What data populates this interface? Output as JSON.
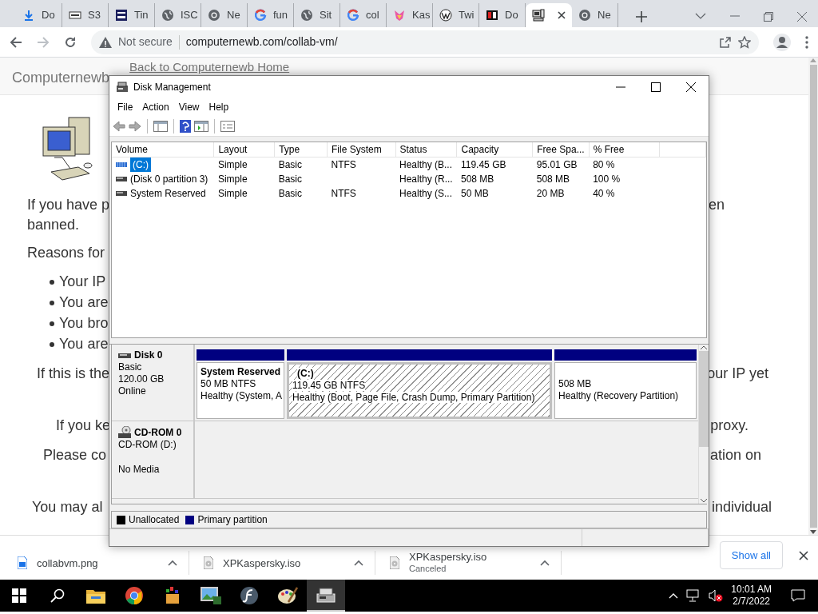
{
  "browser": {
    "tabs": [
      {
        "label": "Do",
        "kind": "download",
        "selected": false
      },
      {
        "label": "S3",
        "kind": "oem",
        "selected": false
      },
      {
        "label": "Tin",
        "kind": "tinyurl",
        "selected": false
      },
      {
        "label": "ISC",
        "kind": "globe",
        "selected": false
      },
      {
        "label": "Ne",
        "kind": "chrome",
        "selected": false
      },
      {
        "label": "fun",
        "kind": "google",
        "selected": false
      },
      {
        "label": "Sit",
        "kind": "globe",
        "selected": false
      },
      {
        "label": "col",
        "kind": "google",
        "selected": false
      },
      {
        "label": "Kas",
        "kind": "fox",
        "selected": false
      },
      {
        "label": "Twi",
        "kind": "wiki",
        "selected": false
      },
      {
        "label": "Do",
        "kind": "nch",
        "selected": false
      },
      {
        "kind": "computer",
        "selected": true
      },
      {
        "label": "Ne",
        "kind": "chrome",
        "selected": false
      }
    ],
    "security": "Not secure",
    "url": "computernewb.com/collab-vm/"
  },
  "website": {
    "brand": "Computernewb",
    "nav_link": "Back to Computernewb Home",
    "lines": [
      {
        "kind": "paragraph",
        "left": "If you have p",
        "right": "en"
      },
      {
        "kind": "paragraph",
        "left": "banned."
      },
      {
        "kind": "paragraph",
        "left": "Reasons for"
      },
      {
        "kind": "bullet",
        "left": "Your IP"
      },
      {
        "kind": "bullet",
        "left": "You are"
      },
      {
        "kind": "bullet",
        "left": "You bro"
      },
      {
        "kind": "bullet",
        "left": "You are"
      },
      {
        "kind": "paragraph",
        "left": "If this is the",
        "right": "our IP yet"
      },
      {
        "kind": "paragraph",
        "left": "If you ke",
        "right": "proxy."
      },
      {
        "kind": "paragraph",
        "left": "Please co",
        "right": "ation on"
      },
      {
        "kind": "paragraph",
        "left": "You may al",
        "right": "individual"
      }
    ]
  },
  "disk_management": {
    "title": "Disk Management",
    "menu": [
      "File",
      "Action",
      "View",
      "Help"
    ],
    "columns": [
      "Volume",
      "Layout",
      "Type",
      "File System",
      "Status",
      "Capacity",
      "Free Spa...",
      "% Free"
    ],
    "volumes": [
      {
        "cells": [
          "(C:)",
          "Simple",
          "Basic",
          "NTFS",
          "Healthy (B...",
          "119.45 GB",
          "95.01 GB",
          "80 %"
        ],
        "selected": true
      },
      {
        "cells": [
          "(Disk 0 partition 3)",
          "Simple",
          "Basic",
          "",
          "Healthy (R...",
          "508 MB",
          "508 MB",
          "100 %"
        ],
        "selected": false
      },
      {
        "cells": [
          "System Reserved",
          "Simple",
          "Basic",
          "NTFS",
          "Healthy (S...",
          "50 MB",
          "20 MB",
          "40 %"
        ],
        "selected": false
      }
    ],
    "disks": [
      {
        "kind": "disk",
        "name": "Disk 0",
        "type": "Basic",
        "size": "120.00 GB",
        "status": "Online",
        "partitions": [
          {
            "name": "System Reserved",
            "size": "50 MB NTFS",
            "status": "Healthy (System, A",
            "selected": false
          },
          {
            "name": "(C:)",
            "size": "119.45 GB NTFS",
            "status": "Healthy (Boot, Page File, Crash Dump, Primary Partition)",
            "selected": true
          },
          {
            "size": "508 MB",
            "status": "Healthy (Recovery Partition)",
            "selected": false
          }
        ]
      },
      {
        "kind": "cdrom",
        "name": "CD-ROM 0",
        "type": "CD-ROM (D:)",
        "status": "No Media"
      }
    ],
    "legend": [
      {
        "label": "Unallocated",
        "color": "#000000"
      },
      {
        "label": "Primary partition",
        "color": "#000080"
      }
    ]
  },
  "downloads": {
    "items": [
      {
        "filename": "collabvm.png",
        "kind": "image"
      },
      {
        "filename": "XPKaspersky.iso",
        "kind": "disc"
      },
      {
        "filename": "XPKaspersky.iso",
        "kind": "disc",
        "status": "Canceled"
      }
    ],
    "show_all": "Show all"
  },
  "taskbar": {
    "apps": [
      {
        "kind": "explorer",
        "selected": false
      },
      {
        "kind": "chrome",
        "selected": false
      },
      {
        "kind": "dosbox",
        "selected": false
      },
      {
        "kind": "viewer",
        "selected": false
      },
      {
        "kind": "flash",
        "selected": false
      },
      {
        "kind": "paint",
        "selected": false
      },
      {
        "kind": "diskmgmt",
        "selected": true
      }
    ],
    "time": "10:01 AM",
    "date": "2/7/2022"
  }
}
